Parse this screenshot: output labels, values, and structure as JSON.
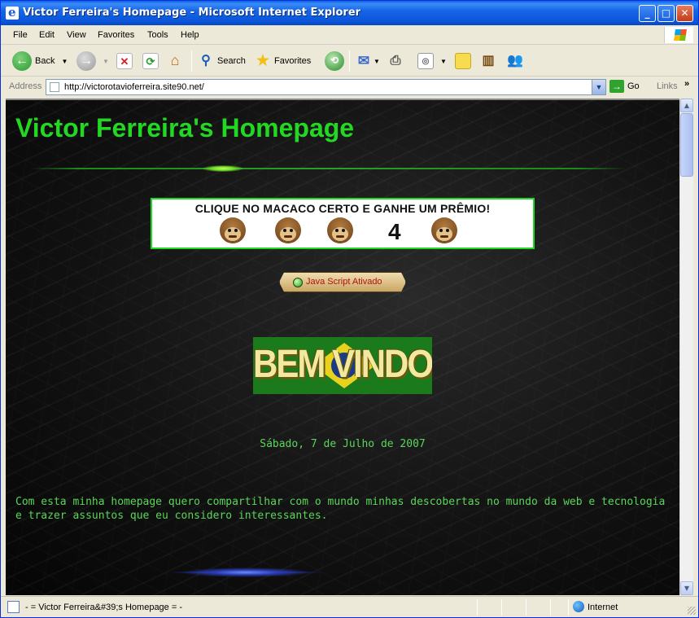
{
  "window": {
    "title": "Victor Ferreira's Homepage - Microsoft Internet Explorer",
    "controls": {
      "minimize": "_",
      "maximize": "□",
      "close": "✕"
    }
  },
  "menu": [
    "File",
    "Edit",
    "View",
    "Favorites",
    "Tools",
    "Help"
  ],
  "toolbar": {
    "back_label": "Back",
    "search_label": "Search",
    "favorites_label": "Favorites"
  },
  "address": {
    "label": "Address",
    "url": "http://victorotavioferreira.site90.net/",
    "go_label": "Go",
    "links_label": "Links"
  },
  "page": {
    "heading": "Victor Ferreira's Homepage",
    "banner_text": "CLIQUE NO MACACO CERTO E GANHE UM PRÊMIO!",
    "banner_number": "4",
    "js_badge": "Java Script Ativado",
    "welcome_text": "BEM VINDO",
    "date": "Sábado, 7 de Julho de 2007",
    "intro": "Com esta minha homepage quero compartilhar com o mundo minhas descobertas no mundo da web e tecnologia e trazer assuntos que eu considero interessantes."
  },
  "status": {
    "text": "- = Victor Ferreira&#39;s Homepage = -",
    "zone": "Internet"
  },
  "colors": {
    "heading_green": "#22d822",
    "text_green": "#5ad65a",
    "xp_blue": "#0a55d9"
  }
}
